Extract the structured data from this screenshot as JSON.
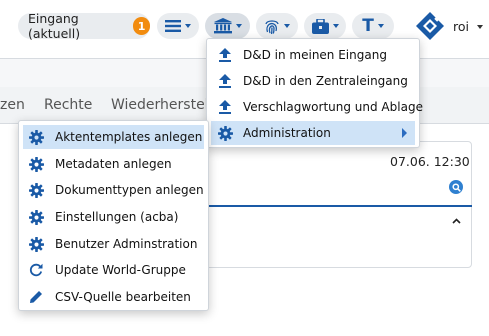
{
  "header": {
    "inbox_label": "Eingang (aktuell)",
    "inbox_count": "1",
    "user_name": "roi"
  },
  "tabs": [
    {
      "label": "zen"
    },
    {
      "label": "Rechte"
    },
    {
      "label": "Wiederherstellen"
    }
  ],
  "card": {
    "date": "07.06. 12:30"
  },
  "upload_menu": {
    "items": [
      {
        "label": "D&D in meinen Eingang",
        "icon": "upload-icon"
      },
      {
        "label": "D&D in den Zentraleingang",
        "icon": "upload-icon"
      },
      {
        "label": "Verschlagwortung und Ablage",
        "icon": "upload-icon"
      },
      {
        "label": "Administration",
        "icon": "gear-icon",
        "highlighted": true,
        "has_submenu": true
      }
    ]
  },
  "admin_menu": {
    "items": [
      {
        "label": "Aktentemplates anlegen",
        "icon": "gear-icon",
        "highlighted": true
      },
      {
        "label": "Metadaten anlegen",
        "icon": "gear-icon"
      },
      {
        "label": "Dokumenttypen anlegen",
        "icon": "gear-icon"
      },
      {
        "label": "Einstellungen (acba)",
        "icon": "gear-icon"
      },
      {
        "label": "Benutzer Adminstration",
        "icon": "gear-icon"
      },
      {
        "label": "Update World-Gruppe",
        "icon": "refresh-icon"
      },
      {
        "label": "CSV-Quelle bearbeiten",
        "icon": "pencil-icon"
      }
    ]
  },
  "colors": {
    "accent": "#1a5aa6",
    "badge": "#f28c0f",
    "highlight": "#cfe3f7"
  }
}
